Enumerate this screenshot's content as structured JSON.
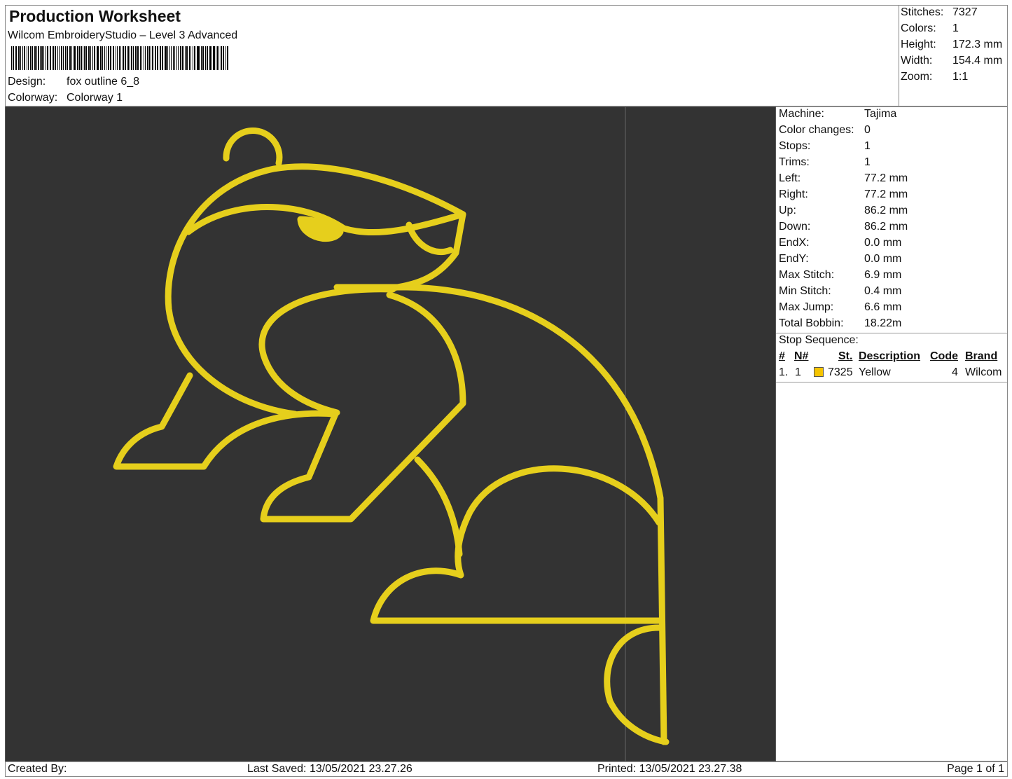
{
  "header": {
    "title": "Production Worksheet",
    "subtitle": "Wilcom EmbroideryStudio – Level 3 Advanced",
    "design_label": "Design:",
    "design_value": "fox outline 6_8",
    "colorway_label": "Colorway:",
    "colorway_value": "Colorway 1"
  },
  "stats": [
    {
      "label": "Stitches:",
      "value": "7327"
    },
    {
      "label": "Colors:",
      "value": "1"
    },
    {
      "label": "Height:",
      "value": "172.3 mm"
    },
    {
      "label": "Width:",
      "value": "154.4 mm"
    },
    {
      "label": "Zoom:",
      "value": "1:1"
    }
  ],
  "machine": [
    {
      "label": "Machine:",
      "value": "Tajima"
    },
    {
      "label": "Color changes:",
      "value": "0"
    },
    {
      "label": "Stops:",
      "value": "1"
    },
    {
      "label": "Trims:",
      "value": "1"
    },
    {
      "label": "Left:",
      "value": "77.2 mm"
    },
    {
      "label": "Right:",
      "value": "77.2 mm"
    },
    {
      "label": "Up:",
      "value": "86.2 mm"
    },
    {
      "label": "Down:",
      "value": "86.2 mm"
    },
    {
      "label": "EndX:",
      "value": "0.0 mm"
    },
    {
      "label": "EndY:",
      "value": "0.0 mm"
    },
    {
      "label": "Max Stitch:",
      "value": "6.9 mm"
    },
    {
      "label": "Min Stitch:",
      "value": "0.4 mm"
    },
    {
      "label": "Max Jump:",
      "value": "6.6 mm"
    },
    {
      "label": "Total Bobbin:",
      "value": "18.22m"
    }
  ],
  "stop_sequence": {
    "title": "Stop Sequence:",
    "headers": [
      "#",
      "N#",
      "St.",
      "Description",
      "Code",
      "Brand"
    ],
    "rows": [
      {
        "num": "1.",
        "n": "1",
        "color": "#f5c400",
        "st": "7325",
        "description": "Yellow",
        "code": "4",
        "brand": "Wilcom"
      }
    ]
  },
  "thread_color": "#e6cf1c",
  "footer": {
    "created_by": "Created By:",
    "last_saved": "Last Saved: 13/05/2021 23.27.26",
    "printed": "Printed: 13/05/2021 23.27.38",
    "page": "Page 1 of 1"
  }
}
